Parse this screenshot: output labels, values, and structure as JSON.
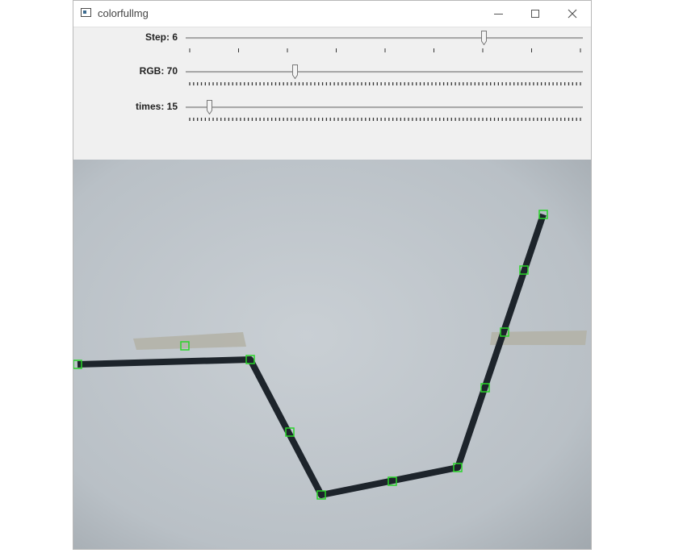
{
  "window": {
    "title": "colorfullmg",
    "icon": "app-window-icon"
  },
  "trackbars": [
    {
      "id": "step",
      "label": "Step: 6",
      "value": 6,
      "max": 8,
      "tick_count": 8
    },
    {
      "id": "rgb",
      "label": "RGB: 70",
      "value": 70,
      "max": 255,
      "tick_count": 100
    },
    {
      "id": "times",
      "label": "times: 15",
      "value": 15,
      "max": 255,
      "tick_count": 100
    }
  ],
  "camera_view": {
    "line_color": "#1d242b",
    "marker_color": "#28d428",
    "background": "#bfc6cc",
    "markers": 13
  }
}
